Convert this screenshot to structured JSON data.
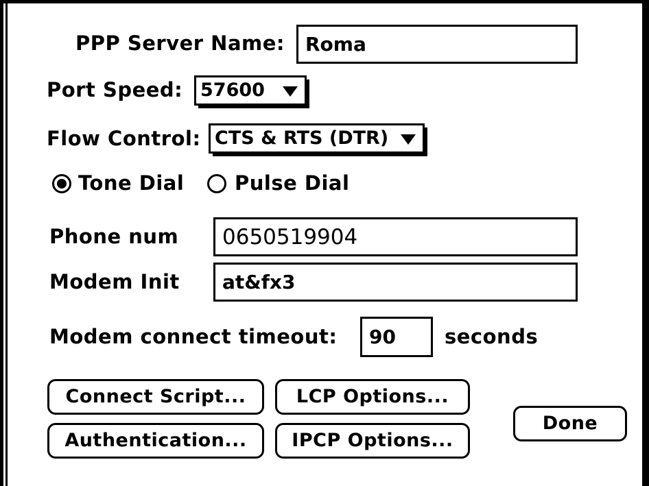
{
  "dialog": {
    "server_name_label": "PPP Server Name:",
    "server_name_value": "Roma",
    "port_speed_label": "Port Speed:",
    "port_speed_value": "57600",
    "flow_control_label": "Flow Control:",
    "flow_control_value": "CTS & RTS (DTR)",
    "dial_mode": {
      "options": [
        "Tone Dial",
        "Pulse Dial"
      ],
      "selected": "Tone Dial"
    },
    "phone_label": "Phone num",
    "phone_value": "0650519904",
    "modem_init_label": "Modem Init",
    "modem_init_value": "at&fx3",
    "timeout_label": "Modem connect timeout:",
    "timeout_value": "90",
    "timeout_unit": "seconds",
    "buttons": {
      "connect_script": "Connect Script...",
      "lcp_options": "LCP Options...",
      "authentication": "Authentication...",
      "ipcp_options": "IPCP Options...",
      "done": "Done"
    }
  },
  "icons": {
    "popup_arrow": "triangle-down-icon",
    "radio_selected": "radio-on-icon",
    "radio_unselected": "radio-off-icon"
  },
  "colors": {
    "foreground": "#000000",
    "background": "#ffffff"
  }
}
